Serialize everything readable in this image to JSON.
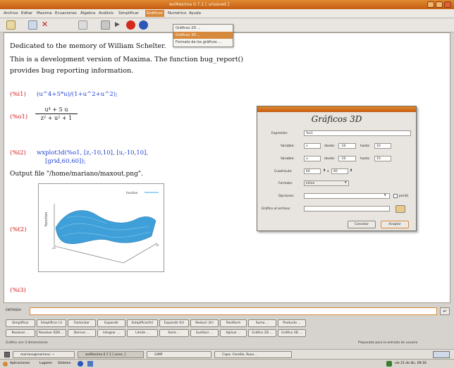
{
  "window": {
    "title": "wxMaxima 0.7.1 [ unsaved ]"
  },
  "menu": [
    "Archivo",
    "Editar",
    "Maxima",
    "Ecuaciones",
    "Álgebra",
    "Análisis",
    "Simplificar",
    "Gráficos",
    "Numérico",
    "Ayuda"
  ],
  "dropdown": [
    "Gráficos 2D ...",
    "Gráficos 3D ...",
    "Formato de los gráficos ..."
  ],
  "doc": {
    "banner": [
      "Dedicated to the memory of William Schelter.",
      "This is a development version of Maxima. The function bug_report()",
      "provides bug reporting information."
    ],
    "i1_label": "(%i1)",
    "i1": "(u^4+5*u)/(1+u^2+u^2);",
    "o1_label": "(%o1)",
    "o1_num": "u⁴ + 5 u",
    "o1_den": "z² + u² + 1",
    "i2_label": "(%i2)",
    "i2_line1": "wxplot3d(%o1, [z,-10,10], [u,-10,10],",
    "i2_line2": "[grid,60,60]);",
    "output_file": "Output file \"/home/mariano/maxout.png\".",
    "t2_label": "(%t2)",
    "i3_label": "(%i3)",
    "plot_legend": "function",
    "plot_ticks": [
      "100",
      "80",
      "60",
      "40",
      "20",
      "0",
      "-20"
    ]
  },
  "dialog": {
    "title": "Gráficos 3D",
    "expresion_label": "Expresión:",
    "expresion_value": "%o1",
    "var_label": "Variable:",
    "desde_label": "desde:",
    "hasta_label": "hasta:",
    "var1": "x",
    "desde1": "-10",
    "hasta1": "10",
    "var2": "u",
    "desde2": "-10",
    "hasta2": "10",
    "cuadricula_label": "Cuadrícula:",
    "cuad1": "60",
    "cuad_x": "x",
    "cuad2": "60",
    "formato_label": "Formato:",
    "formato_value": "inline",
    "opciones_label": "Opciones:",
    "pm3d_label": "pm3d",
    "grafico_label": "Gráfico al archivo:",
    "cancelar": "Cancelar",
    "aceptar": "Aceptar"
  },
  "input": {
    "label": "ENTRADA:",
    "value": ""
  },
  "buttons_row1": [
    "Simplificar",
    "Simplificar (r)",
    "Factorizar",
    "Expandir",
    "Simplificar(tr)",
    "Expandir (tr)",
    "Reducir (tr)",
    "Rectform",
    "Suma ...",
    "Producto ..."
  ],
  "buttons_row2": [
    "Resolver ...",
    "Resolver EDO ...",
    "Derivar ...",
    "Integrar ...",
    "Límite ...",
    "Serie ...",
    "Sustituir ...",
    "Aplicar ...",
    "Gráfico 2D ...",
    "Gráfico 3D ..."
  ],
  "status": {
    "left": "Gráfico con 3 dimensiones",
    "right": "Preparado para la entrada de usuario"
  },
  "taskbar": [
    "mariano@mariano: ~",
    "wxMaxima 0.7.1 [ unsa..]",
    "GIMP",
    "Capa: Cereillo, Ruso..."
  ],
  "panel": {
    "apps": "Aplicaciones",
    "places": "Lugares",
    "system": "Sistema",
    "clock": "vie 21 de dic, 09:16"
  },
  "colors": {
    "orange": "#d88a3c",
    "label_red": "#d21a1a",
    "input_blue": "#1d3fd1",
    "surface": "#3fa0d9"
  }
}
